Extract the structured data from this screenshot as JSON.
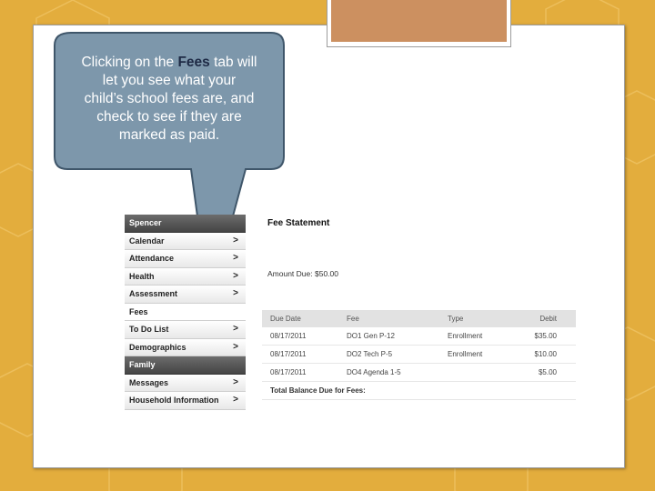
{
  "callout": {
    "line1_pre": "Clicking on the ",
    "line1_highlight": "Fees",
    "line1_post": " tab will",
    "line2": "let you see what your",
    "line3": "child’s school fees are, and",
    "line4": "check to see if they are",
    "line5": "marked as paid."
  },
  "sidebar": {
    "student_name": "Spencer",
    "items": [
      {
        "label": "Calendar"
      },
      {
        "label": "Attendance"
      },
      {
        "label": "Health"
      },
      {
        "label": "Assessment"
      }
    ],
    "active_item": "Fees",
    "items_after": [
      {
        "label": "To Do List"
      },
      {
        "label": "Demographics"
      }
    ],
    "family_header": "Family",
    "family_items": [
      {
        "label": "Messages"
      },
      {
        "label": "Household Information"
      }
    ],
    "chevron": ">"
  },
  "statement": {
    "title": "Fee Statement",
    "amount_due_label": "Amount Due:",
    "amount_due_value": "$50.00",
    "columns": [
      "Due Date",
      "Fee",
      "Type",
      "Debit"
    ],
    "rows": [
      [
        "08/17/2011",
        "DO1 Gen P-12",
        "Enrollment",
        "$35.00"
      ],
      [
        "08/17/2011",
        "DO2 Tech P-5",
        "Enrollment",
        "$10.00"
      ],
      [
        "08/17/2011",
        "DO4 Agenda 1-5",
        "",
        "$5.00"
      ]
    ],
    "total_label": "Total Balance Due for Fees:"
  },
  "colors": {
    "background": "#e3ad3d",
    "accent": "#cc9060",
    "callout_fill": "#7d97ab",
    "callout_border": "#3f566a",
    "sidebar_header": "#4f4f4f"
  }
}
